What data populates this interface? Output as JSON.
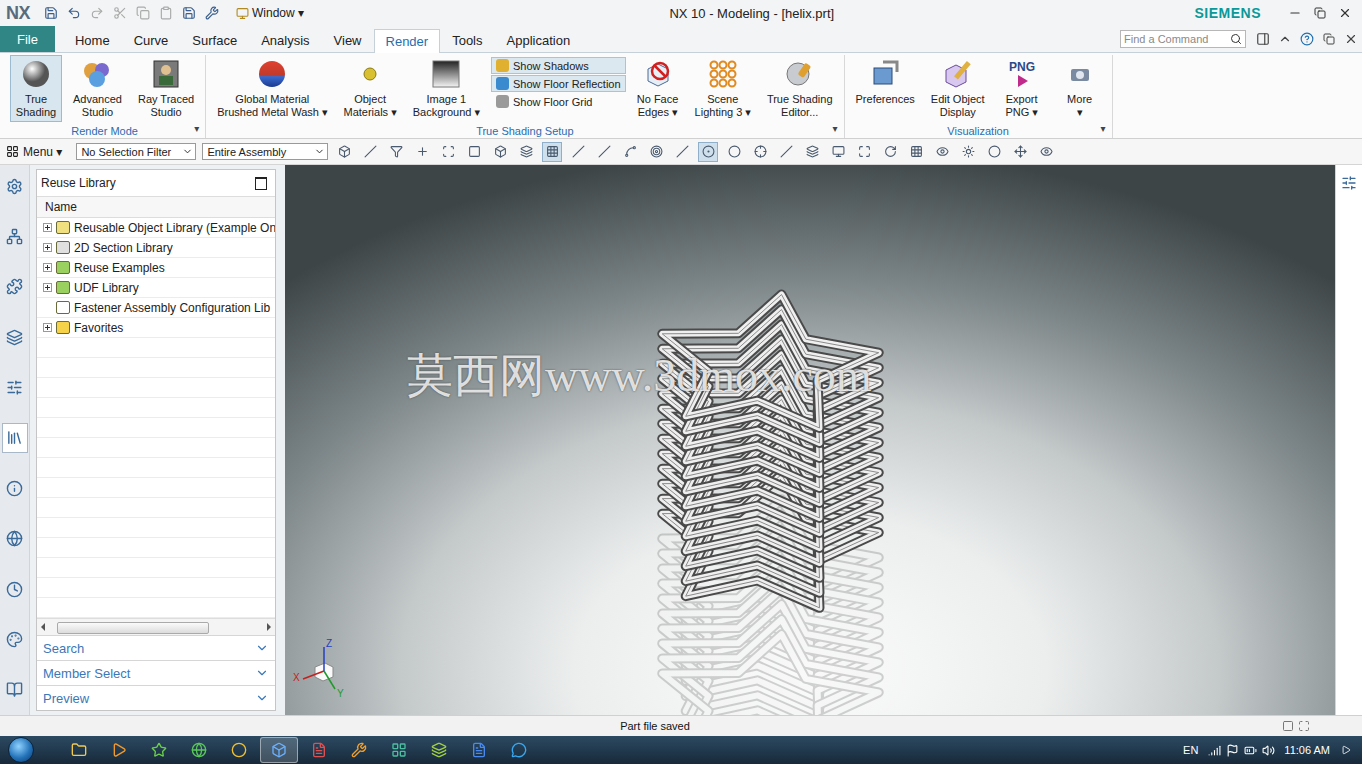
{
  "window": {
    "app": "NX",
    "title": "NX 10 - Modeling - [helix.prt]",
    "brand": "SIEMENS",
    "window_menu": "Window ▾"
  },
  "tabs": [
    {
      "label": "File",
      "selected": false,
      "kind": "file"
    },
    {
      "label": "Home",
      "selected": false,
      "kind": "tab"
    },
    {
      "label": "Curve",
      "selected": false,
      "kind": "tab"
    },
    {
      "label": "Surface",
      "selected": false,
      "kind": "tab"
    },
    {
      "label": "Analysis",
      "selected": false,
      "kind": "tab"
    },
    {
      "label": "View",
      "selected": false,
      "kind": "tab"
    },
    {
      "label": "Render",
      "selected": true,
      "kind": "tab"
    },
    {
      "label": "Tools",
      "selected": false,
      "kind": "tab"
    },
    {
      "label": "Application",
      "selected": false,
      "kind": "tab"
    }
  ],
  "search": {
    "placeholder": "Find a Command"
  },
  "ribbon": {
    "groups": [
      {
        "label": "Render Mode",
        "more": "▾",
        "items": [
          {
            "kind": "large",
            "lines": [
              "True",
              "Shading"
            ],
            "selected": true
          },
          {
            "kind": "large",
            "lines": [
              "Advanced",
              "Studio"
            ],
            "selected": false
          },
          {
            "kind": "large",
            "lines": [
              "Ray Traced",
              "Studio"
            ],
            "selected": false
          }
        ]
      },
      {
        "label": "True Shading Setup",
        "more": "▾",
        "items": [
          {
            "kind": "large",
            "lines": [
              "Global Material",
              "Brushed Metal Wash ▾"
            ],
            "selected": false
          },
          {
            "kind": "large",
            "lines": [
              "Object",
              "Materials ▾"
            ],
            "selected": false
          },
          {
            "kind": "large",
            "lines": [
              "Image 1",
              "Background ▾"
            ],
            "selected": false
          },
          {
            "kind": "toggles",
            "toggles": [
              {
                "label": "Show Shadows",
                "on": true
              },
              {
                "label": "Show Floor Reflection",
                "on": true
              },
              {
                "label": "Show Floor Grid",
                "on": false
              }
            ]
          },
          {
            "kind": "large",
            "lines": [
              "No Face",
              "Edges ▾"
            ],
            "selected": false
          },
          {
            "kind": "large",
            "lines": [
              "Scene",
              "Lighting 3 ▾"
            ],
            "selected": false
          },
          {
            "kind": "large",
            "lines": [
              "True Shading",
              "Editor..."
            ],
            "selected": false
          }
        ]
      },
      {
        "label": "Visualization",
        "more": "▾",
        "items": [
          {
            "kind": "large",
            "lines": [
              "Preferences"
            ],
            "selected": false
          },
          {
            "kind": "large",
            "lines": [
              "Edit Object",
              "Display"
            ],
            "selected": false
          },
          {
            "kind": "large",
            "lines": [
              "Export",
              "PNG ▾"
            ],
            "selected": false,
            "icon_text": "PNG"
          },
          {
            "kind": "large",
            "lines": [
              "More",
              "▾"
            ],
            "selected": false
          }
        ]
      }
    ]
  },
  "toolbar": {
    "menu": "Menu ▾",
    "selection_filter": "No Selection Filter",
    "scope": "Entire Assembly",
    "tools": [
      {
        "active": false
      },
      {
        "active": false
      },
      {
        "active": false
      },
      {
        "active": false
      },
      {
        "active": false
      },
      {
        "active": false
      },
      {
        "active": false
      },
      {
        "active": false
      },
      {
        "active": true
      },
      {
        "active": false
      },
      {
        "active": false
      },
      {
        "active": false
      },
      {
        "active": false
      },
      {
        "active": false
      },
      {
        "active": true
      },
      {
        "active": false
      },
      {
        "active": false
      },
      {
        "active": false
      },
      {
        "active": false
      },
      {
        "active": false
      },
      {
        "active": false
      },
      {
        "active": false
      },
      {
        "active": false
      },
      {
        "active": false
      },
      {
        "active": false
      },
      {
        "active": false
      },
      {
        "active": false
      },
      {
        "active": false
      }
    ]
  },
  "left_rail": [
    {
      "selected": false
    },
    {
      "selected": false
    },
    {
      "selected": false
    },
    {
      "selected": false
    },
    {
      "selected": false
    },
    {
      "selected": true
    },
    {
      "selected": false
    },
    {
      "selected": false
    },
    {
      "selected": false
    },
    {
      "selected": false
    },
    {
      "selected": false
    }
  ],
  "resource_panel": {
    "title": "Reuse Library",
    "column": "Name",
    "items": [
      {
        "label": "Reusable Object Library (Example On",
        "expandable": true,
        "expanded": false
      },
      {
        "label": "2D Section Library",
        "expandable": true,
        "expanded": false
      },
      {
        "label": "Reuse Examples",
        "expandable": true,
        "expanded": false
      },
      {
        "label": "UDF Library",
        "expandable": true,
        "expanded": false
      },
      {
        "label": "Fastener Assembly Configuration Lib",
        "expandable": false,
        "expanded": false
      },
      {
        "label": "Favorites",
        "expandable": true,
        "expanded": false
      }
    ],
    "sections": [
      "Search",
      "Member Select",
      "Preview"
    ]
  },
  "viewport": {
    "watermark": "莫西网www.3dmox.com",
    "axes": [
      {
        "label": "Z",
        "color": "#2440c0"
      },
      {
        "label": "X",
        "color": "#c42020"
      },
      {
        "label": "Y",
        "color": "#1f9a2a"
      }
    ]
  },
  "status_bar": {
    "message": "Part file saved"
  },
  "taskbar": {
    "apps": [
      {
        "active": false
      },
      {
        "active": false
      },
      {
        "active": false
      },
      {
        "active": false
      },
      {
        "active": false
      },
      {
        "active": true
      },
      {
        "active": false
      },
      {
        "active": false
      },
      {
        "active": false
      },
      {
        "active": false
      },
      {
        "active": false
      },
      {
        "active": false
      }
    ],
    "language": "EN",
    "time": "11:06 AM"
  }
}
